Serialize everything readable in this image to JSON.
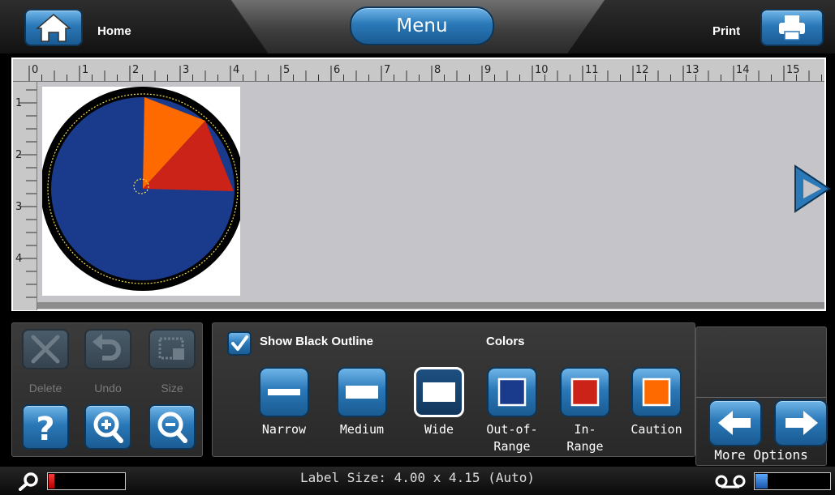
{
  "header": {
    "home_label": "Home",
    "menu_label": "Menu",
    "print_label": "Print"
  },
  "ruler": {
    "top_marks": [
      "0",
      "1",
      "2",
      "3",
      "4",
      "5",
      "6",
      "7",
      "8",
      "9",
      "10",
      "11",
      "12",
      "13",
      "14",
      "15"
    ],
    "left_marks": [
      "1",
      "2",
      "3",
      "4"
    ]
  },
  "label": {
    "pie_colors": {
      "out_of_range": "#1a3a8c",
      "in_range": "#cc2318",
      "caution": "#ff6a00",
      "outline": "#000000"
    }
  },
  "tools": {
    "delete_label": "Delete",
    "undo_label": "Undo",
    "size_label": "Size"
  },
  "options": {
    "show_outline_label": "Show Black Outline",
    "show_outline_checked": true,
    "colors_label": "Colors",
    "buttons": [
      {
        "label": "Narrow",
        "icon": "narrow-line-icon",
        "selected": false
      },
      {
        "label": "Medium",
        "icon": "medium-line-icon",
        "selected": false
      },
      {
        "label": "Wide",
        "icon": "wide-line-icon",
        "selected": true
      },
      {
        "label_line1": "Out-of-",
        "label_line2": "Range",
        "icon": "out-of-range-swatch",
        "color": "#1a3a8c"
      },
      {
        "label_line1": "In-",
        "label_line2": "Range",
        "icon": "in-range-swatch",
        "color": "#cc2318"
      },
      {
        "label": "Caution",
        "icon": "caution-swatch",
        "color": "#ff6a00"
      }
    ]
  },
  "more": {
    "label": "More Options"
  },
  "status": {
    "label_size_text": "Label Size: 4.00 x 4.15 (Auto)",
    "ink_level": 0.08,
    "tape_level": 0.17
  },
  "colors": {
    "accent_blue": "#2a78b8",
    "ink_red": "#e01010",
    "tape_blue": "#2a6fd0"
  }
}
